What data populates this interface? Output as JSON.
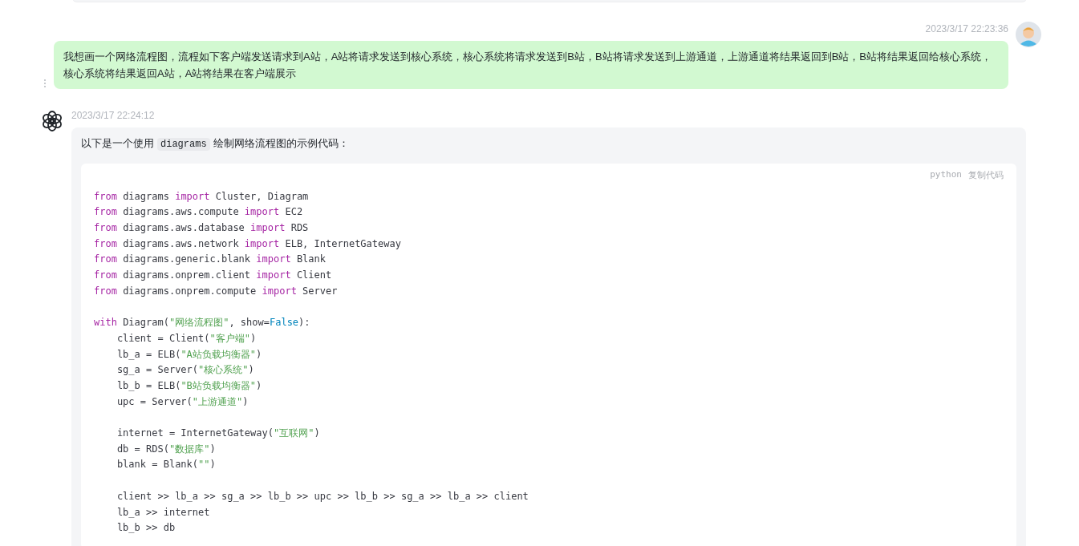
{
  "user_message": {
    "timestamp": "2023/3/17 22:23:36",
    "text": "我想画一个网络流程图，流程如下客户端发送请求到A站，A站将请求发送到核心系统，核心系统将请求发送到B站，B站将请求发送到上游通道，上游通道将结果返回到B站，B站将结果返回给核心系统，核心系统将结果返回A站，A站将结果在客户端展示"
  },
  "assistant_message": {
    "timestamp": "2023/3/17 22:24:12",
    "intro": [
      {
        "kind": "text",
        "text": "以下是一个使用"
      },
      {
        "kind": "code",
        "text": "diagrams"
      },
      {
        "kind": "text",
        "text": "绘制网络流程图的示例代码："
      }
    ],
    "code_block": {
      "language": "python",
      "copy_label": "复制代码",
      "blocks": [
        [
          [
            {
              "kind": "keyword",
              "text": "from"
            },
            {
              "kind": "plain",
              "text": " diagrams "
            },
            {
              "kind": "keyword",
              "text": "import"
            },
            {
              "kind": "plain",
              "text": " Cluster, Diagram"
            }
          ],
          [
            {
              "kind": "keyword",
              "text": "from"
            },
            {
              "kind": "plain",
              "text": " diagrams.aws.compute "
            },
            {
              "kind": "keyword",
              "text": "import"
            },
            {
              "kind": "plain",
              "text": " EC2"
            }
          ],
          [
            {
              "kind": "keyword",
              "text": "from"
            },
            {
              "kind": "plain",
              "text": " diagrams.aws.database "
            },
            {
              "kind": "keyword",
              "text": "import"
            },
            {
              "kind": "plain",
              "text": " RDS"
            }
          ],
          [
            {
              "kind": "keyword",
              "text": "from"
            },
            {
              "kind": "plain",
              "text": " diagrams.aws.network "
            },
            {
              "kind": "keyword",
              "text": "import"
            },
            {
              "kind": "plain",
              "text": " ELB, InternetGateway"
            }
          ],
          [
            {
              "kind": "keyword",
              "text": "from"
            },
            {
              "kind": "plain",
              "text": " diagrams.generic.blank "
            },
            {
              "kind": "keyword",
              "text": "import"
            },
            {
              "kind": "plain",
              "text": " Blank"
            }
          ],
          [
            {
              "kind": "keyword",
              "text": "from"
            },
            {
              "kind": "plain",
              "text": " diagrams.onprem.client "
            },
            {
              "kind": "keyword",
              "text": "import"
            },
            {
              "kind": "plain",
              "text": " Client"
            }
          ],
          [
            {
              "kind": "keyword",
              "text": "from"
            },
            {
              "kind": "plain",
              "text": " diagrams.onprem.compute "
            },
            {
              "kind": "keyword",
              "text": "import"
            },
            {
              "kind": "plain",
              "text": " Server"
            }
          ]
        ],
        [
          [
            {
              "kind": "keyword",
              "text": "with"
            },
            {
              "kind": "plain",
              "text": " Diagram("
            },
            {
              "kind": "string",
              "text": "\"网络流程图\""
            },
            {
              "kind": "plain",
              "text": ", show="
            },
            {
              "kind": "constant",
              "text": "False"
            },
            {
              "kind": "plain",
              "text": "):"
            }
          ],
          [
            {
              "kind": "plain",
              "text": "    client = Client("
            },
            {
              "kind": "string",
              "text": "\"客户端\""
            },
            {
              "kind": "plain",
              "text": ")"
            }
          ],
          [
            {
              "kind": "plain",
              "text": "    lb_a = ELB("
            },
            {
              "kind": "string",
              "text": "\"A站负载均衡器\""
            },
            {
              "kind": "plain",
              "text": ")"
            }
          ],
          [
            {
              "kind": "plain",
              "text": "    sg_a = Server("
            },
            {
              "kind": "string",
              "text": "\"核心系统\""
            },
            {
              "kind": "plain",
              "text": ")"
            }
          ],
          [
            {
              "kind": "plain",
              "text": "    lb_b = ELB("
            },
            {
              "kind": "string",
              "text": "\"B站负载均衡器\""
            },
            {
              "kind": "plain",
              "text": ")"
            }
          ],
          [
            {
              "kind": "plain",
              "text": "    upc = Server("
            },
            {
              "kind": "string",
              "text": "\"上游通道\""
            },
            {
              "kind": "plain",
              "text": ")"
            }
          ]
        ],
        [
          [
            {
              "kind": "plain",
              "text": "    internet = InternetGateway("
            },
            {
              "kind": "string",
              "text": "\"互联网\""
            },
            {
              "kind": "plain",
              "text": ")"
            }
          ],
          [
            {
              "kind": "plain",
              "text": "    db = RDS("
            },
            {
              "kind": "string",
              "text": "\"数据库\""
            },
            {
              "kind": "plain",
              "text": ")"
            }
          ],
          [
            {
              "kind": "plain",
              "text": "    blank = Blank("
            },
            {
              "kind": "string",
              "text": "\"\""
            },
            {
              "kind": "plain",
              "text": ")"
            }
          ]
        ],
        [
          [
            {
              "kind": "plain",
              "text": "    client >> lb_a >> sg_a >> lb_b >> upc >> lb_b >> sg_a >> lb_a >> client"
            }
          ],
          [
            {
              "kind": "plain",
              "text": "    lb_a >> internet"
            }
          ],
          [
            {
              "kind": "plain",
              "text": "    lb_b >> db"
            }
          ]
        ]
      ]
    }
  }
}
